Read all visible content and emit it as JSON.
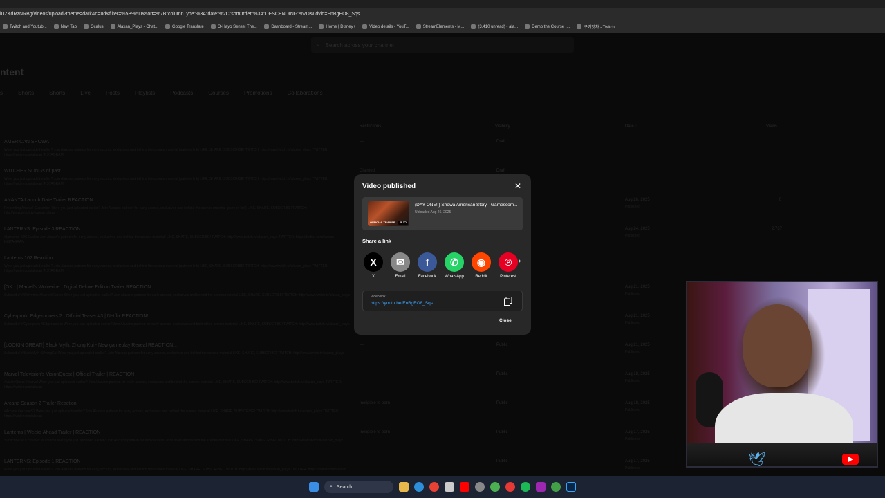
{
  "browser": {
    "url": "lUZKdRzNRBg/videos/upload?theme=dark&d=ud&filter=%5B%5D&sort=%7B\"columnType\"%3A\"date\"%2C\"sortOrder\"%3A\"DESCENDING\"%7D&udvid=EnBgEO8_Sqs",
    "bookmarks": [
      "Twitch and Youtub...",
      "New Tab",
      "Oculus",
      "Alaxan_Plays - Chat...",
      "Google Translate",
      "O-Hayo Sensei The...",
      "Dashboard - Stream...",
      "Home | Disney+",
      "Video details - YouT...",
      "StreamElements - M...",
      "(3,410 unread) - ala...",
      "Demo the Course |...",
      "쿠키맛차 - Twitch"
    ]
  },
  "studio": {
    "search_placeholder": "Search across your channel",
    "heading": "ntent",
    "tabs": [
      "s",
      "Shorts",
      "Shorts",
      "Live",
      "Posts",
      "Playlists",
      "Podcasts",
      "Courses",
      "Promotions",
      "Collaborations"
    ],
    "columns": {
      "restrictions": "Restrictions",
      "visibility": "Visibility",
      "date": "Date ↓",
      "views": "Views"
    },
    "rows": [
      {
        "title": "AMERICAN SHOWA",
        "desc": "Were you just uploaded earlier? Join Alaxans patreon for early access, exclusives and behind the scenes material (patreon link) LIKE, SHARE, SUBSCRIBE! TWITCH: http://www.twitch.tv/alaxan_plays TWITTER: https://twitter.com/alaxan INSTAGRAM",
        "restriction": "—",
        "visibility": "Draft",
        "date": "",
        "date_sub": "",
        "views": ""
      },
      {
        "title": "WITCHER SONGs of past",
        "desc": "Were you just uploaded earlier? Join Alaxans patreon for early access, exclusives and behind the scenes material (patreon link) LIKE, SHARE, SUBSCRIBE! TWITCH: http://www.twitch.tv/alaxan_plays TWITTER: https://twitter.com/alaxan INSTAGRAM",
        "restriction": "Claimed",
        "visibility": "Draft",
        "date": "",
        "date_sub": "",
        "views": ""
      },
      {
        "title": "ANANTA Launch Date Trailer REACTION",
        "desc": "Presenting Ananta! Subscribe! Were you just uploaded earlier? Join Alaxans patreon for early access, exclusives and behind the scenes material (patreon link) LIKE, SHARE, SUBSCRIBE! TWITCH: http://www.twitch.tv/alaxan_plays",
        "restriction": "—",
        "visibility": "Public",
        "date": "Aug 26, 2025",
        "date_sub": "Published",
        "views": "0"
      },
      {
        "title": "LANTERNS: Episode 3 REACTION",
        "desc": "#Lanterns #DCStudios Join Alaxan's patreon for early access, exclusives and behind the scenes material! LIKE, SHARE, SUBSCRIBE! TWITCH: http://www.twitch.tv/alaxan_plays TWITTER: https://twitter.com/alaxan INSTAGRAM",
        "restriction": "—",
        "visibility": "Public",
        "date": "Aug 24, 2025",
        "date_sub": "Published",
        "views": "2,737"
      },
      {
        "title": "Lanterns 102 Reaction",
        "desc": "Were you just uploaded earlier? Join Alaxans patreon for early access, exclusives and behind the scenes material (patreon link) LIKE, SHARE, SUBSCRIBE! TWITCH: http://www.twitch.tv/alaxan_plays TWITTER: https://twitter.com/alaxan INSTAGRAM",
        "restriction": "—",
        "visibility": "Draft",
        "date": "",
        "date_sub": "",
        "views": ""
      },
      {
        "title": "[OK...] Marvel's Wolverine | Digital Deluxe Edition Trailer REACTION",
        "desc": "Subscribe! #Wolverine #MarvelGames Were you just uploaded earlier? Join Alaxans patreon for early access, exclusives and behind the scenes material LIKE, SHARE, SUBSCRIBE! TWITCH: http://www.twitch.tv/alaxan_plays",
        "restriction": "—",
        "visibility": "Public",
        "date": "Aug 21, 2025",
        "date_sub": "Published",
        "views": ""
      },
      {
        "title": "Cyberpunk: Edgerunners 2 | Official Teaser #3 | Netflix REACTION!",
        "desc": "Subscribe! #Cyberpunk #Edgerunners Were you just uploaded earlier? Join Alaxans patreon for early access, exclusives and behind the scenes material LIKE, SHARE, SUBSCRIBE! TWITCH: http://www.twitch.tv/alaxan_plays",
        "restriction": "—",
        "visibility": "Public",
        "date": "Aug 21, 2025",
        "date_sub": "Published",
        "views": ""
      },
      {
        "title": "[LOOKIN GREAT!] Black Myth: Zhong Kui  - New gameplay Reveal REACTION...",
        "desc": "Subscribe! #BlackMyth #ZhongKui Were you just uploaded earlier? Join Alaxans patreon for early access, exclusives and behind the scenes material LIKE, SHARE, SUBSCRIBE! TWITCH: http://www.twitch.tv/alaxan_plays",
        "restriction": "—",
        "visibility": "Public",
        "date": "Aug 21, 2025",
        "date_sub": "Published",
        "views": ""
      },
      {
        "title": "Marvel Television's VisionQuest | Official Trailer | REACTION",
        "desc": "#VisionQuest #Marvel Were you just uploaded earlier? Join Alaxans patreon for early access, exclusives and behind the scenes material LIKE, SHARE, SUBSCRIBE! TWITCH: http://www.twitch.tv/alaxan_plays TWITTER: https://twitter.com/alaxan",
        "restriction": "—",
        "visibility": "Public",
        "date": "Aug 18, 2025",
        "date_sub": "Published",
        "views": ""
      },
      {
        "title": "Arcane Season 2 Trailer Reaction",
        "desc": "#Arcane #ArcaneS2 Were you just uploaded earlier? Join Alaxans patreon for early access, exclusives and behind the scenes material LIKE, SHARE, SUBSCRIBE! TWITCH: http://www.twitch.tv/alaxan_plays TWITTER: https://twitter.com/alaxan",
        "restriction": "Ineligible to earn",
        "visibility": "Public",
        "date": "Aug 18, 2025",
        "date_sub": "Published",
        "views": ""
      },
      {
        "title": "Lanterns | Weeks Ahead Trailer | REACTION",
        "desc": "Subscribe! #DCStudios #Lanterns Were you just uploaded earlier? Join Alaxans patreon for early access, exclusives and behind the scenes material LIKE, SHARE, SUBSCRIBE! TWITCH: http://www.twitch.tv/alaxan_plays",
        "restriction": "Ineligible to earn",
        "visibility": "Public",
        "date": "Aug 17, 2025",
        "date_sub": "Published",
        "views": ""
      },
      {
        "title": "LANTERNS: Episode 1 REACTION",
        "desc": "Were you just uploaded earlier? Join Alaxans patreon for early access, exclusives and behind the scenes material LIKE, SHARE, SUBSCRIBE! TWITCH: http://www.twitch.tv/alaxan_plays TWITTER: https://twitter.com/alaxan",
        "restriction": "—",
        "visibility": "Public",
        "date": "Aug 17, 2025",
        "date_sub": "Published",
        "views": ""
      }
    ]
  },
  "dialog": {
    "title": "Video published",
    "video_title": "(DAY ONE!!) Showa American Story - Gamescom...",
    "video_date": "Uploaded Aug 26, 2025",
    "thumbnail_label": "OFFICIAL TRAILER",
    "duration": "4:15",
    "share_label": "Share a link",
    "share_targets": [
      {
        "name": "X",
        "color": "#000000",
        "glyph": "X"
      },
      {
        "name": "Email",
        "color": "#888888",
        "glyph": "✉"
      },
      {
        "name": "Facebook",
        "color": "#3b5998",
        "glyph": "f"
      },
      {
        "name": "WhatsApp",
        "color": "#25d366",
        "glyph": "✆"
      },
      {
        "name": "Reddit",
        "color": "#ff4500",
        "glyph": "◉"
      },
      {
        "name": "Pinterest",
        "color": "#e60023",
        "glyph": "℗"
      }
    ],
    "link_label": "Video link",
    "link_url": "https://youtu.be/EnBgEO8_Sqs",
    "close_label": "Close"
  },
  "taskbar": {
    "search_label": "Search"
  }
}
